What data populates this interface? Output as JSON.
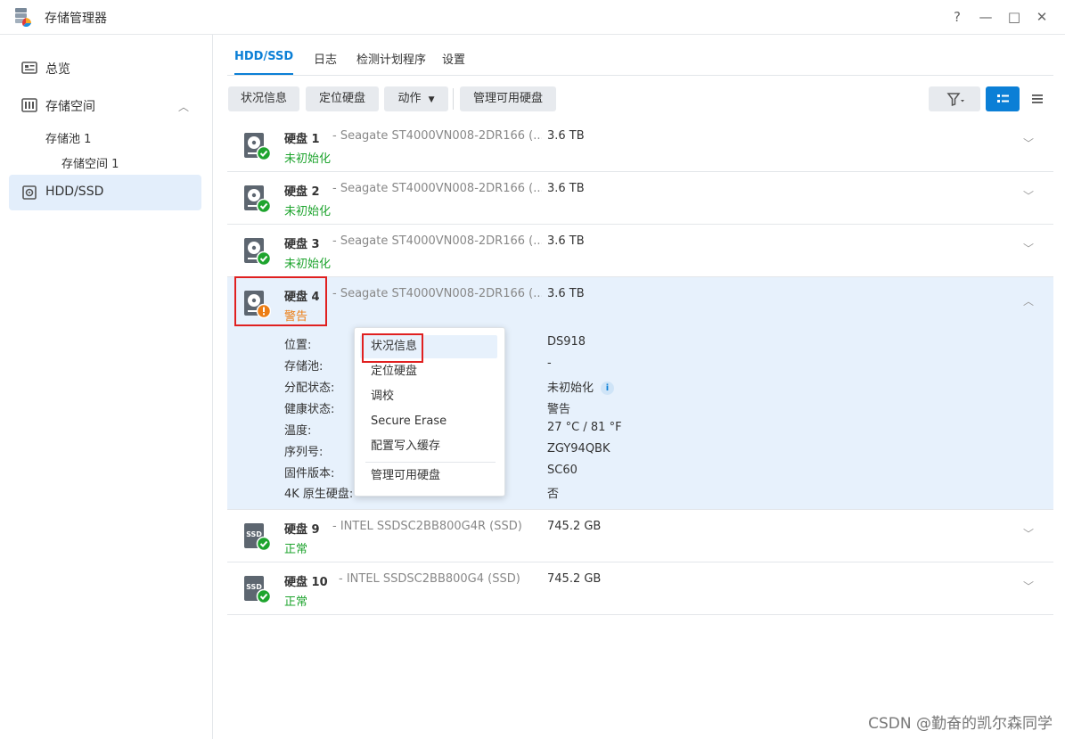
{
  "window": {
    "title": "存储管理器",
    "controls": {
      "help": "?",
      "minimize": "—",
      "maximize": "□",
      "close": "✕"
    }
  },
  "sidebar": {
    "items": [
      {
        "label": "总览",
        "icon": "overview-icon"
      },
      {
        "label": "存储空间",
        "icon": "storage-icon",
        "expanded": true,
        "children": [
          {
            "label": "存储池 1"
          },
          {
            "label": "存储空间 1"
          }
        ]
      },
      {
        "label": "HDD/SSD",
        "icon": "disk-icon",
        "active": true
      }
    ]
  },
  "tabs": [
    {
      "label": "HDD/SSD",
      "active": true
    },
    {
      "label": "日志"
    },
    {
      "label": "检测计划程序"
    },
    {
      "label": "设置"
    }
  ],
  "toolbar": {
    "health_info": "状况信息",
    "locate": "定位硬盘",
    "action": "动作",
    "manage_available": "管理可用硬盘"
  },
  "disks": [
    {
      "name": "硬盘 1",
      "model": " - Seagate ST4000VN008-2DR166 (...",
      "size": "3.6 TB",
      "status": "未初始化",
      "status_type": "ok",
      "type": "HDD"
    },
    {
      "name": "硬盘 2",
      "model": " - Seagate ST4000VN008-2DR166 (...",
      "size": "3.6 TB",
      "status": "未初始化",
      "status_type": "ok",
      "type": "HDD"
    },
    {
      "name": "硬盘 3",
      "model": " - Seagate ST4000VN008-2DR166 (...",
      "size": "3.6 TB",
      "status": "未初始化",
      "status_type": "ok",
      "type": "HDD"
    },
    {
      "name": "硬盘 4",
      "model": " - Seagate ST4000VN008-2DR166 (...",
      "size": "3.6 TB",
      "status": "警告",
      "status_type": "warn",
      "type": "HDD",
      "expanded": true
    },
    {
      "name": "硬盘 9",
      "model": " - INTEL SSDSC2BB800G4R (SSD)",
      "size": "745.2 GB",
      "status": "正常",
      "status_type": "ok",
      "type": "SSD"
    },
    {
      "name": "硬盘 10",
      "model": " - INTEL SSDSC2BB800G4 (SSD)",
      "size": "745.2 GB",
      "status": "正常",
      "status_type": "ok",
      "type": "SSD"
    }
  ],
  "disk4_details": {
    "labels": [
      "位置:",
      "存储池:",
      "分配状态:",
      "健康状态:",
      "温度:",
      "序列号:",
      "固件版本:",
      "4K 原生硬盘:"
    ],
    "values": [
      "DS918",
      "-",
      "未初始化",
      "警告",
      "27 °C / 81 °F",
      "ZGY94QBK",
      "SC60",
      "否"
    ]
  },
  "context_menu": {
    "items": [
      "状况信息",
      "定位硬盘",
      "调校",
      "Secure Erase",
      "配置写入缓存",
      "管理可用硬盘"
    ]
  },
  "watermark": "CSDN @勤奋的凯尔森同学",
  "colors": {
    "accent": "#0b7fd6",
    "ok": "#1ea42e",
    "warning": "#ec7d14",
    "highlight": "#e02020"
  }
}
